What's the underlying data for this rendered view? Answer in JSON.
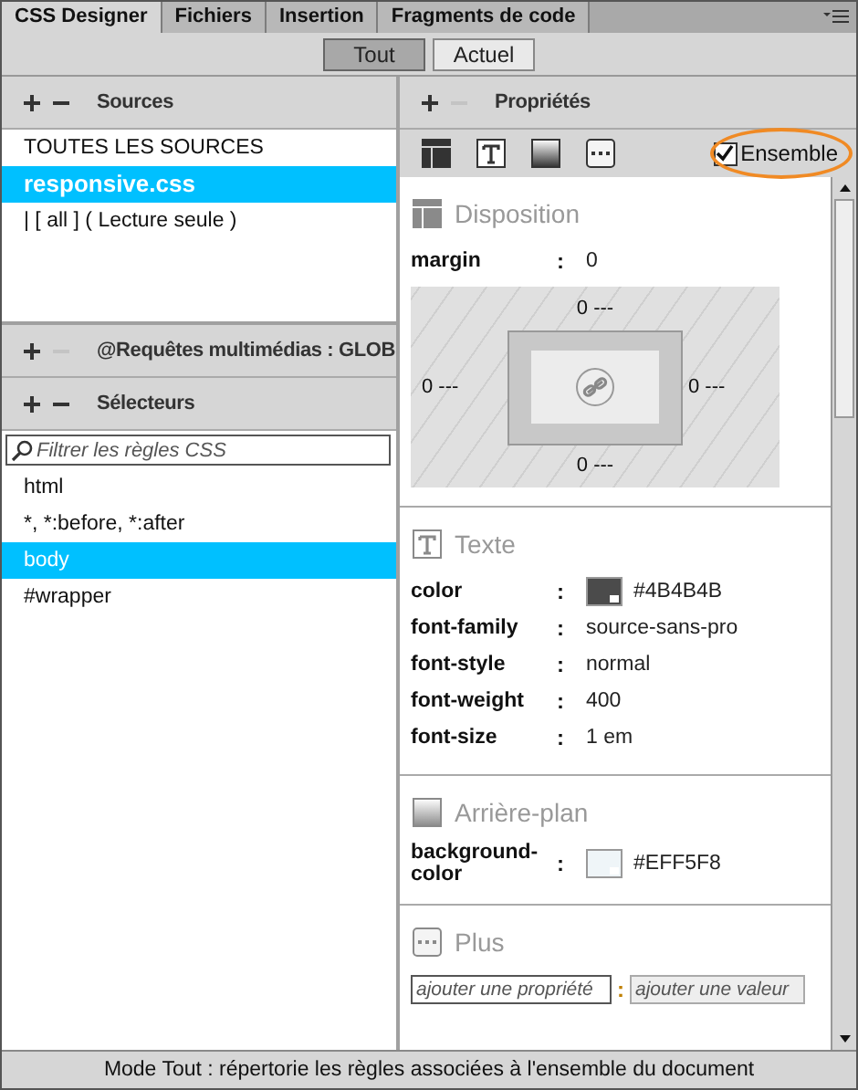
{
  "tabs": [
    {
      "label": "CSS Designer",
      "selected": true
    },
    {
      "label": "Fichiers",
      "selected": false
    },
    {
      "label": "Insertion",
      "selected": false
    },
    {
      "label": "Fragments de code",
      "selected": false
    }
  ],
  "mode_buttons": [
    {
      "label": "Tout",
      "selected": true
    },
    {
      "label": "Actuel",
      "selected": false
    }
  ],
  "sources": {
    "title": "Sources",
    "remove_enabled": true,
    "items": [
      {
        "label": "TOUTES LES SOURCES",
        "selected": false
      },
      {
        "label": "responsive.css",
        "selected": true
      },
      {
        "label": "| [ all ] ( Lecture seule )",
        "selected": false
      }
    ]
  },
  "media_queries": {
    "title": "@Requêtes multimédias : GLOB",
    "remove_enabled": false
  },
  "selectors": {
    "title": "Sélecteurs",
    "remove_enabled": true,
    "filter": {
      "placeholder": "Filtrer les règles CSS"
    },
    "items": [
      {
        "label": "html",
        "selected": false
      },
      {
        "label": "*, *:before, *:after",
        "selected": false
      },
      {
        "label": "body",
        "selected": true
      },
      {
        "label": "#wrapper",
        "selected": false
      }
    ]
  },
  "properties": {
    "title": "Propriétés",
    "remove_enabled": false,
    "show_set": {
      "label": "Ensemble",
      "checked": true,
      "highlighted": true
    },
    "sections": [
      {
        "kind": "layout",
        "title": "Disposition",
        "margin": {
          "name": "margin",
          "colon": ":",
          "value": "0",
          "top": "0 ---",
          "right": "0 ---",
          "bottom": "0 ---",
          "left": "0 ---"
        }
      },
      {
        "kind": "text",
        "title": "Texte",
        "rows": [
          {
            "name": "color",
            "colon": ":",
            "value": "#4B4B4B",
            "color": "#4b4b4b"
          },
          {
            "name": "font-family",
            "colon": ":",
            "value": "source-sans-pro"
          },
          {
            "name": "font-style",
            "colon": ":",
            "value": "normal"
          },
          {
            "name": "font-weight",
            "colon": ":",
            "value": "400"
          },
          {
            "name": "font-size",
            "colon": ":",
            "value": "1 em"
          }
        ]
      },
      {
        "kind": "background",
        "title": "Arrière-plan",
        "rows": [
          {
            "name": "background-color",
            "colon": ":",
            "value": "#EFF5F8",
            "color": "#eff5f8"
          }
        ]
      },
      {
        "kind": "more",
        "title": "Plus",
        "property_placeholder": "ajouter une propriété",
        "colon": ":",
        "value_placeholder": "ajouter une valeur"
      }
    ]
  },
  "status_bar": "Mode Tout : répertorie les règles associées à l'ensemble du document"
}
